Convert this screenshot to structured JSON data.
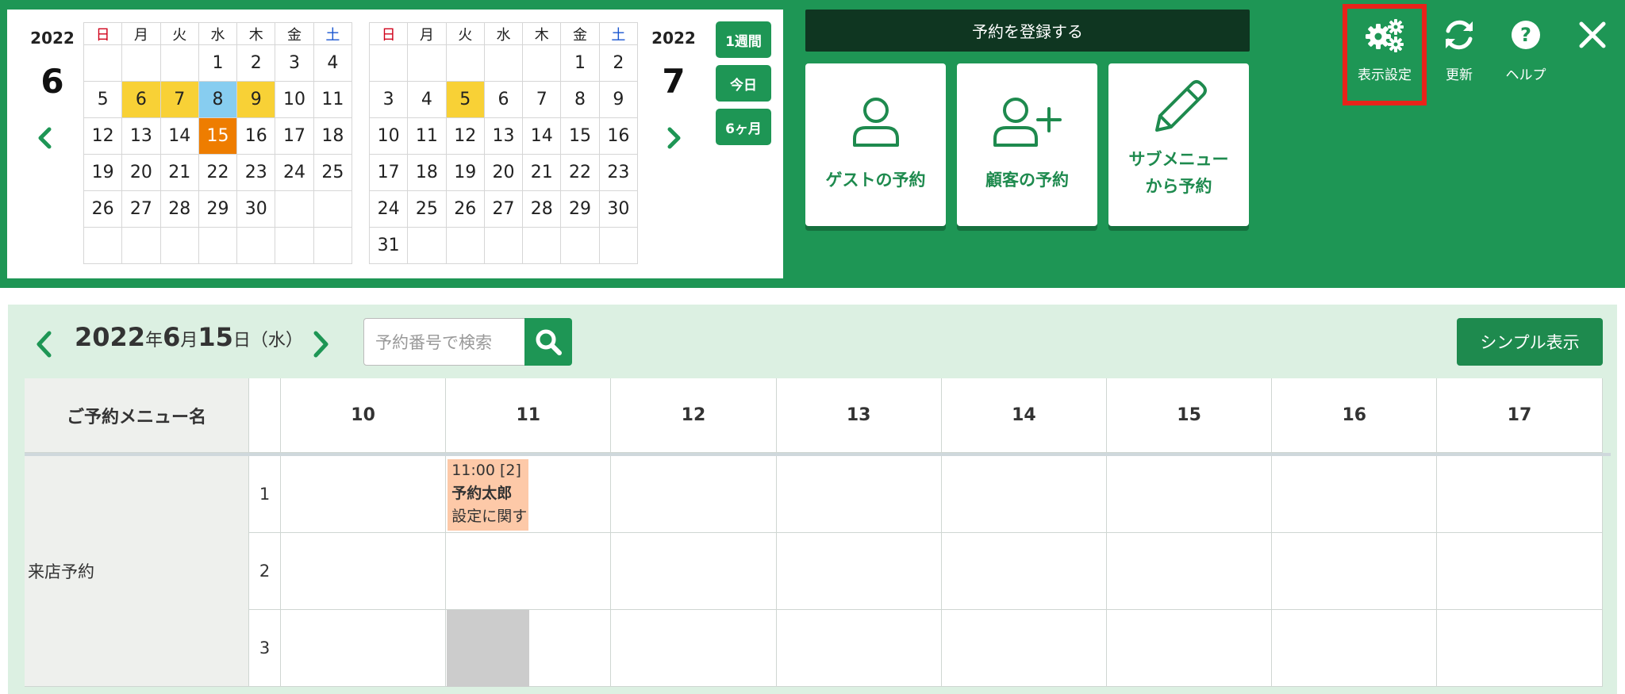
{
  "calendar": {
    "weekdays": [
      "日",
      "月",
      "火",
      "水",
      "木",
      "金",
      "土"
    ],
    "left": {
      "year": "2022",
      "month": "6",
      "weeks": [
        [
          "",
          "",
          "",
          "1",
          "2",
          "3",
          "4"
        ],
        [
          "5",
          "6",
          "7",
          "8",
          "9",
          "10",
          "11"
        ],
        [
          "12",
          "13",
          "14",
          "15",
          "16",
          "17",
          "18"
        ],
        [
          "19",
          "20",
          "21",
          "22",
          "23",
          "24",
          "25"
        ],
        [
          "26",
          "27",
          "28",
          "29",
          "30",
          "",
          ""
        ],
        [
          "",
          "",
          "",
          "",
          "",
          "",
          ""
        ]
      ]
    },
    "right": {
      "year": "2022",
      "month": "7",
      "weeks": [
        [
          "",
          "",
          "",
          "",
          "",
          "1",
          "2"
        ],
        [
          "3",
          "4",
          "5",
          "6",
          "7",
          "8",
          "9"
        ],
        [
          "10",
          "11",
          "12",
          "13",
          "14",
          "15",
          "16"
        ],
        [
          "17",
          "18",
          "19",
          "20",
          "21",
          "22",
          "23"
        ],
        [
          "24",
          "25",
          "26",
          "27",
          "28",
          "29",
          "30"
        ],
        [
          "31",
          "",
          "",
          "",
          "",
          "",
          ""
        ]
      ]
    },
    "range_buttons": [
      "1週間",
      "今日",
      "6ヶ月"
    ]
  },
  "register": {
    "header": "予約を登録する",
    "cards": [
      {
        "line1": "ゲストの予約",
        "line2": ""
      },
      {
        "line1": "顧客の予約",
        "line2": ""
      },
      {
        "line1": "サブメニュー",
        "line2": "から予約"
      }
    ]
  },
  "tools": {
    "display_settings": "表示設定",
    "refresh": "更新",
    "help": "ヘルプ"
  },
  "schedule": {
    "date": {
      "year": "2022",
      "year_unit": "年",
      "month": "6",
      "month_unit": "月",
      "day": "15",
      "day_unit": "日",
      "weekday": "（水）"
    },
    "search_placeholder": "予約番号で検索",
    "simple_view": "シンプル表示",
    "menu_header": "ご予約メニュー名",
    "hours": [
      "10",
      "11",
      "12",
      "13",
      "14",
      "15",
      "16",
      "17"
    ],
    "menu_name": "来店予約",
    "rows": [
      "1",
      "2",
      "3"
    ],
    "booking": {
      "time": "11:00 [2]",
      "name": "予約太郎",
      "note": "設定に関す"
    }
  },
  "colors": {
    "brand_green": "#1e9655",
    "dark_green": "#0f3621",
    "panel_bg": "#dcf0e2",
    "highlight_yellow": "#f8d136",
    "highlight_blue": "#87cdf0",
    "today_orange": "#ee7d00",
    "booking_peach": "#fdc9a8",
    "focus_red": "#e8231a"
  }
}
